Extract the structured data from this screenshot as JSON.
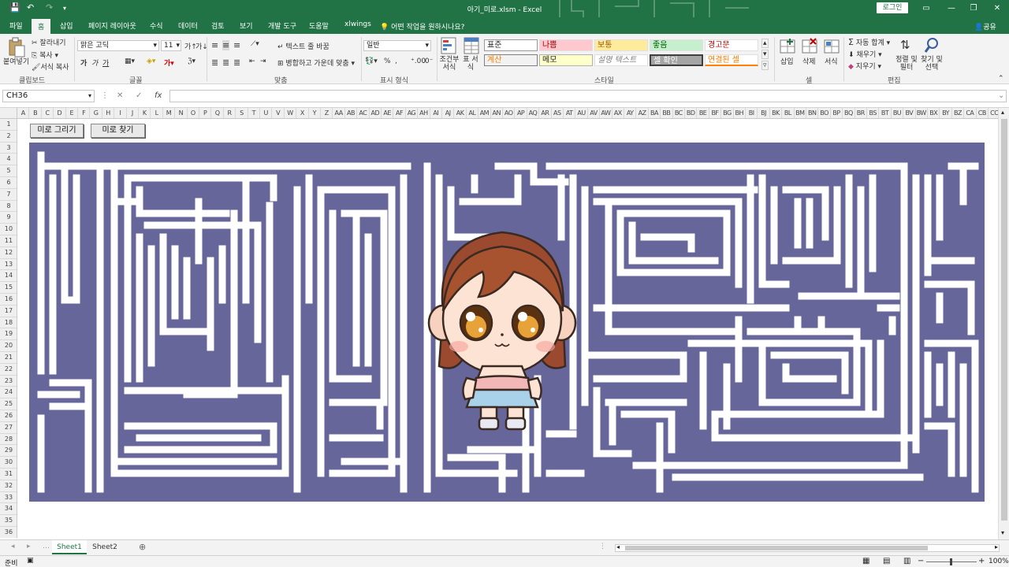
{
  "window": {
    "title": "아기_미로.xlsm  -  Excel",
    "login_label": "로그인"
  },
  "tabs": [
    "파일",
    "홈",
    "삽입",
    "페이지 레이아웃",
    "수식",
    "데이터",
    "검토",
    "보기",
    "개발 도구",
    "도움말",
    "xlwings"
  ],
  "active_tab": "홈",
  "tell_me": "어떤 작업을 원하시나요?",
  "share_label": "공유",
  "ribbon": {
    "clipboard": {
      "paste": "붙여넣기",
      "cut": "잘라내기",
      "copy": "복사",
      "format_painter": "서식 복사",
      "group": "클립보드"
    },
    "font": {
      "name": "맑은 고딕",
      "size": "11",
      "bold": "가",
      "italic": "가",
      "underline": "가",
      "group": "글꼴"
    },
    "alignment": {
      "wrap_text": "텍스트 줄 바꿈",
      "merge_center": "병합하고 가운데 맞춤",
      "group": "맞춤"
    },
    "number": {
      "format": "일반",
      "percent": "%",
      "group": "표시 형식"
    },
    "styles": {
      "conditional": "조건부 서식",
      "table": "표 서식",
      "cells": [
        "표준",
        "나쁨",
        "보통",
        "좋음",
        "경고문",
        "계산",
        "메모",
        "설명 텍스트",
        "셀 확인",
        "연결된 셀"
      ],
      "group": "스타일"
    },
    "cells": {
      "insert": "삽입",
      "delete": "삭제",
      "format": "서식",
      "group": "셀"
    },
    "editing": {
      "autosum": "자동 합계",
      "fill": "채우기",
      "clear": "지우기",
      "sort_filter": "정렬 및 필터",
      "find_select": "찾기 및 선택",
      "group": "편집"
    }
  },
  "formula_bar": {
    "name_box": "CH36",
    "fx": "fx",
    "cancel": "✕",
    "enter": "✓",
    "value": ""
  },
  "columns": [
    "A",
    "B",
    "C",
    "D",
    "E",
    "F",
    "G",
    "H",
    "I",
    "J",
    "K",
    "L",
    "M",
    "N",
    "O",
    "P",
    "Q",
    "R",
    "S",
    "T",
    "U",
    "V",
    "W",
    "X",
    "Y",
    "Z",
    "AA",
    "AB",
    "AC",
    "AD",
    "AE",
    "AF",
    "AG",
    "AH",
    "AI",
    "AJ",
    "AK",
    "AL",
    "AM",
    "AN",
    "AO",
    "AP",
    "AQ",
    "AR",
    "AS",
    "AT",
    "AU",
    "AV",
    "AW",
    "AX",
    "AY",
    "AZ",
    "BA",
    "BB",
    "BC",
    "BD",
    "BE",
    "BF",
    "BG",
    "BH",
    "BI",
    "BJ",
    "BK",
    "BL",
    "BM",
    "BN",
    "BO",
    "BP",
    "BQ",
    "BR",
    "BS",
    "BT",
    "BU",
    "BV",
    "BW",
    "BX",
    "BY",
    "BZ",
    "CA",
    "CB",
    "CC"
  ],
  "rows": [
    "1",
    "2",
    "3",
    "4",
    "5",
    "6",
    "7",
    "8",
    "9",
    "10",
    "11",
    "12",
    "13",
    "14",
    "15",
    "16",
    "17",
    "18",
    "19",
    "20",
    "21",
    "22",
    "23",
    "24",
    "25",
    "26",
    "27",
    "28",
    "29",
    "30",
    "31",
    "32",
    "33",
    "34",
    "35",
    "36"
  ],
  "buttons": {
    "draw_maze": "미로 그리기",
    "find_maze": "미로 찾기"
  },
  "maze_color": "#66669a",
  "sheets": [
    "Sheet1",
    "Sheet2"
  ],
  "active_sheet": "Sheet1",
  "status": {
    "ready": "준비",
    "zoom": "100%"
  },
  "colors": {
    "excel_green": "#217346",
    "maze_wall": "#66669a"
  }
}
